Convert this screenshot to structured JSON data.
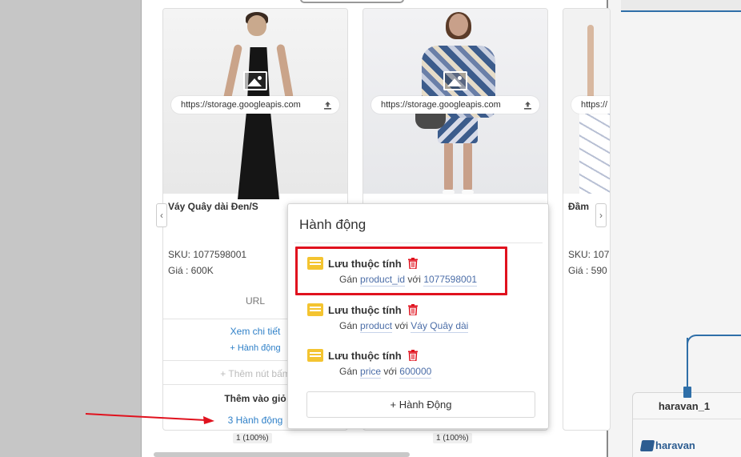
{
  "products": [
    {
      "url": "https://storage.googleapis.com",
      "name": "Váy Quây dài Đen/S",
      "sku": "SKU: 1077598001",
      "price": "Giá : 600K",
      "url_label": "URL",
      "detail_link": "Xem chi tiết",
      "action_link": "+ Hành động",
      "add_button": "+ Thêm nút bấm",
      "cart_label": "Thêm vào giỏ",
      "cart_actions": "3 Hành động",
      "percent": "1 (100%)"
    },
    {
      "url": "https://storage.googleapis.com",
      "percent": "1 (100%)"
    },
    {
      "url": "https://",
      "name": "Đầm",
      "sku": "SKU: 107",
      "price": "Giá : 590"
    }
  ],
  "popup": {
    "title": "Hành động",
    "actions": [
      {
        "label": "Lưu thuộc tính",
        "prefix": "Gán",
        "attr": "product_id",
        "joiner": "với",
        "value": "1077598001"
      },
      {
        "label": "Lưu thuộc tính",
        "prefix": "Gán",
        "attr": "product",
        "joiner": "với",
        "value": "Váy Quây dài"
      },
      {
        "label": "Lưu thuộc tính",
        "prefix": "Gán",
        "attr": "price",
        "joiner": "với",
        "value": "600000"
      }
    ],
    "add_button": "+ Hành Động"
  },
  "node": {
    "title": "haravan_1",
    "logo_text": "haravan"
  },
  "colors": {
    "link": "#2f80c8",
    "highlight": "#e0121e",
    "trash": "#e0121e",
    "list_icon": "#f4c430",
    "connector": "#2f6fa8"
  }
}
